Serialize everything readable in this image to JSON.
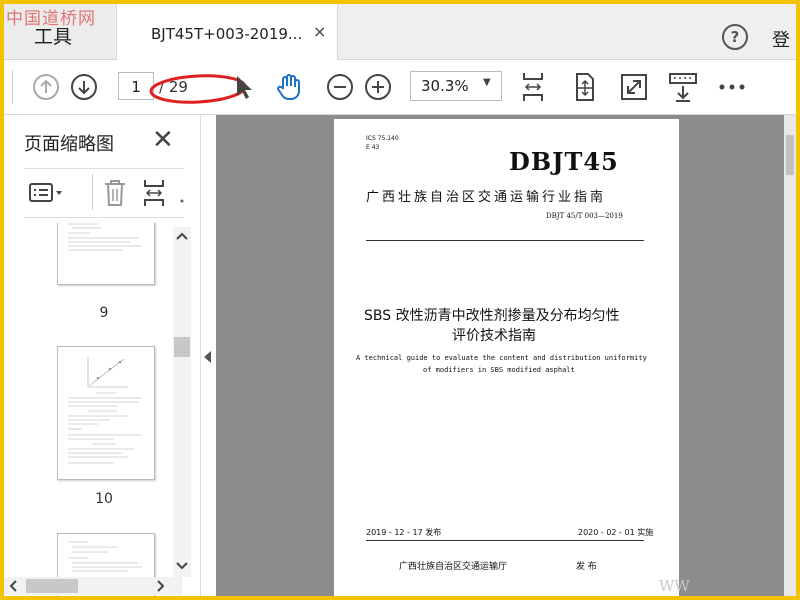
{
  "watermark": {
    "top_left": "中国道桥网",
    "bottom_right": "WW"
  },
  "tabbar": {
    "tools_label": "工具",
    "doc_tab_label": "BJT45T+003-2019...",
    "close_glyph": "×",
    "help_glyph": "?",
    "login_label": "登"
  },
  "toolbar": {
    "page_current": "1",
    "page_total": "/ 29",
    "zoom_value": "30.3%",
    "annotation_color": "#e02020"
  },
  "leftpane": {
    "title": "页面缩略图",
    "close_glyph": "✕",
    "thumbnails": [
      {
        "label": "9"
      },
      {
        "label": "10"
      }
    ]
  },
  "document": {
    "ics": "ICS 75.140",
    "e_code": "E 43",
    "code": "DBJT45",
    "org": "广西壮族自治区交通运输行业指南",
    "std_number": "DBJT 45/T 003—2019",
    "title_line1": "SBS 改性沥青中改性剂掺量及分布均匀性",
    "title_line2": "评价技术指南",
    "en_line1": "A technical guide to evaluate the content and distribution uniformity",
    "en_line2": "of modifiers in SBS modified asphalt",
    "issue_date": "2019 - 12 - 17 发布",
    "impl_date": "2020 - 02 - 01 实施",
    "dept": "广西壮族自治区交通运输厅",
    "publish": "发 布"
  }
}
